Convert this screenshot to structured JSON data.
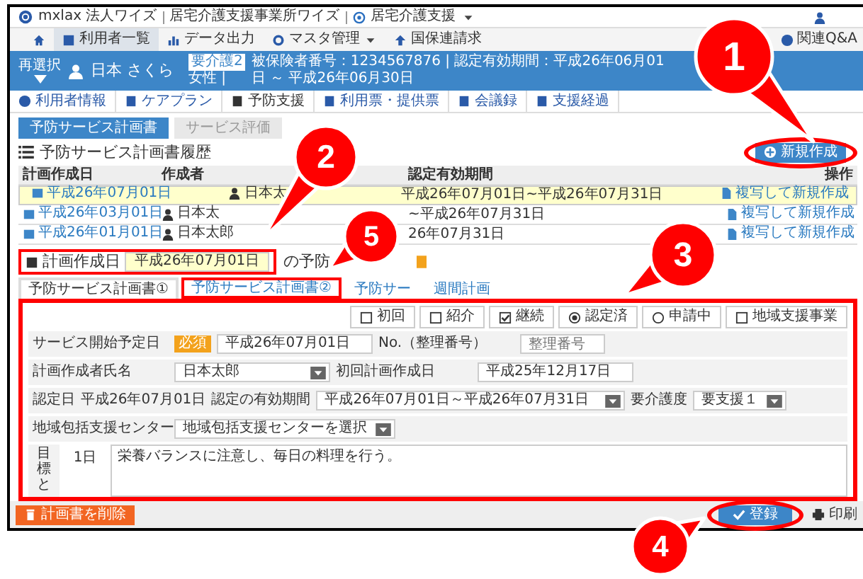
{
  "header": {
    "breadcrumb": [
      "mxlax 法人ワイズ",
      "居宅介護支援事業所ワイズ",
      "居宅介護支援"
    ]
  },
  "nav": {
    "items": [
      {
        "label": "利用者一覧",
        "selected": true
      },
      {
        "label": "データ出力",
        "selected": false
      },
      {
        "label": "マスタ管理",
        "selected": false
      },
      {
        "label": "国保連請求",
        "selected": false
      }
    ],
    "help": "関連Q&A"
  },
  "user_bar": {
    "reselect": "再選択",
    "name": "日本 さくら",
    "care_level": "要介護2",
    "info": "被保険者番号：1234567876 | 認定有効期間：平成26年06月01日 ～ 平成26年06月30日",
    "gender": "女性 |"
  },
  "subtabs": [
    {
      "label": "利用者情報",
      "selected": false
    },
    {
      "label": "ケアプラン",
      "selected": false
    },
    {
      "label": "予防支援",
      "selected": true
    },
    {
      "label": "利用票・提供票",
      "selected": false
    },
    {
      "label": "会議録",
      "selected": false
    },
    {
      "label": "支援経過",
      "selected": false
    }
  ],
  "doc_buttons": [
    {
      "label": "予防サービス計画書",
      "selected": true
    },
    {
      "label": "サービス評価",
      "selected": false
    }
  ],
  "history": {
    "title": "予防サービス計画書履歴",
    "new_button": {
      "label": "新規作成",
      "highlighted": true
    },
    "columns": [
      "計画作成日",
      "作成者",
      "認定有効期間",
      "操作"
    ],
    "rows": [
      {
        "date": "平成26年07月01日",
        "author": "日本太",
        "period": "平成26年07月01日~平成26年07月31日",
        "action": "複写して新規作成",
        "selected": true
      },
      {
        "date": "平成26年03月01日",
        "author": "日本太",
        "period": "~平成26年07月31日",
        "action": "複写して新規作成",
        "selected": false
      },
      {
        "date": "平成26年01月01日",
        "author": "日本太郎",
        "period": "26年07月31日",
        "action": "複写して新規作成",
        "selected": false
      }
    ]
  },
  "plan_date": {
    "label": "計画作成日",
    "value": "平成26年07月01日",
    "highlighted": true,
    "suffix": "の予防"
  },
  "tabs": [
    {
      "label": "予防サービス計画書①",
      "selected": true,
      "highlighted": false
    },
    {
      "label": "予防サービス計画書②",
      "selected": false,
      "highlighted": true
    },
    {
      "label": "予防サー",
      "selected": false,
      "highlighted": false
    },
    {
      "label": "週間計画",
      "selected": false,
      "highlighted": false
    }
  ],
  "form": {
    "highlighted": true,
    "options": [
      {
        "kind": "checkbox",
        "label": "初回",
        "checked": false
      },
      {
        "kind": "checkbox",
        "label": "紹介",
        "checked": false
      },
      {
        "kind": "checkbox",
        "label": "継続",
        "checked": true
      },
      {
        "kind": "radio",
        "label": "認定済",
        "selected": true
      },
      {
        "kind": "radio",
        "label": "申請中",
        "selected": false
      },
      {
        "kind": "checkbox",
        "label": "地域支援事業",
        "checked": false
      }
    ],
    "service_start": {
      "label": "サービス開始予定日",
      "required": "必須",
      "value": "平成26年07月01日"
    },
    "number": {
      "label": "No.（整理番号）",
      "placeholder": "整理番号"
    },
    "planner": {
      "label": "計画作成者氏名",
      "value": "日本太郎"
    },
    "first_plan": {
      "label": "初回計画作成日",
      "value": "平成25年12月17日"
    },
    "cert_date": {
      "label": "認定日",
      "value": "平成26年07月01日"
    },
    "validity": {
      "label": "認定の有効期間",
      "value": "平成26年07月01日～平成26年07月31日"
    },
    "care_level": {
      "label": "要介護度",
      "value": "要支援１"
    },
    "center": {
      "label": "地域包括支援センター",
      "value": "地域包括支援センターを選択"
    },
    "goal": {
      "side": "目標と",
      "day": "1日",
      "text": "栄養バランスに注意し、毎日の料理を行う。"
    }
  },
  "footer": {
    "delete": "計画書を削除",
    "register": {
      "label": "登録",
      "highlighted": true
    },
    "print": "印刷"
  },
  "callouts": [
    {
      "number": "1"
    },
    {
      "number": "2"
    },
    {
      "number": "3"
    },
    {
      "number": "4"
    },
    {
      "number": "5"
    }
  ]
}
